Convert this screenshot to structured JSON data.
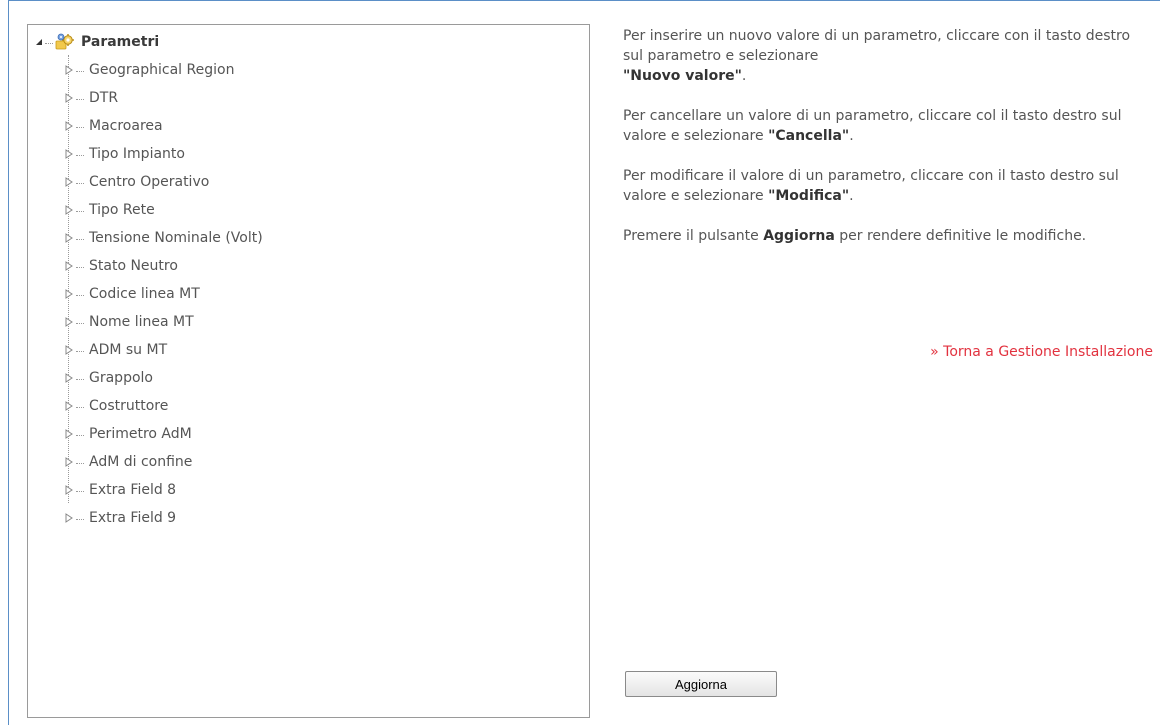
{
  "tree": {
    "root": {
      "label": "Parametri",
      "icon": "gear-folder-icon"
    },
    "items": [
      {
        "label": "Geographical Region"
      },
      {
        "label": "DTR"
      },
      {
        "label": "Macroarea"
      },
      {
        "label": "Tipo Impianto"
      },
      {
        "label": "Centro Operativo"
      },
      {
        "label": "Tipo Rete"
      },
      {
        "label": "Tensione Nominale (Volt)"
      },
      {
        "label": "Stato Neutro"
      },
      {
        "label": "Codice linea MT"
      },
      {
        "label": "Nome linea MT"
      },
      {
        "label": "ADM su MT"
      },
      {
        "label": "Grappolo"
      },
      {
        "label": "Costruttore"
      },
      {
        "label": "Perimetro AdM"
      },
      {
        "label": "AdM di confine"
      },
      {
        "label": "Extra Field 8"
      },
      {
        "label": "Extra Field 9"
      }
    ]
  },
  "instructions": {
    "insert": {
      "text": "Per inserire un nuovo valore di un parametro, cliccare con il tasto destro sul parametro e selezionare",
      "bold": "\"Nuovo valore\"",
      "end": "."
    },
    "delete": {
      "text": "Per cancellare un valore di un parametro, cliccare col il tasto destro sul valore e selezionare",
      "bold": "\"Cancella\"",
      "end": "."
    },
    "modify": {
      "text": "Per modificare il valore di un parametro, cliccare con il tasto destro sul valore e selezionare",
      "bold": "\"Modifica\"",
      "end": "."
    },
    "update": {
      "pre": "Premere il pulsante",
      "bold": "Aggiorna",
      "post": "per rendere definitive le modifiche."
    }
  },
  "back_link": "» Torna a Gestione Installazione",
  "update_button": "Aggiorna",
  "colors": {
    "frame_border": "#5b8fc7",
    "link": "#e2323f",
    "panel_border": "#9a9a9a"
  }
}
